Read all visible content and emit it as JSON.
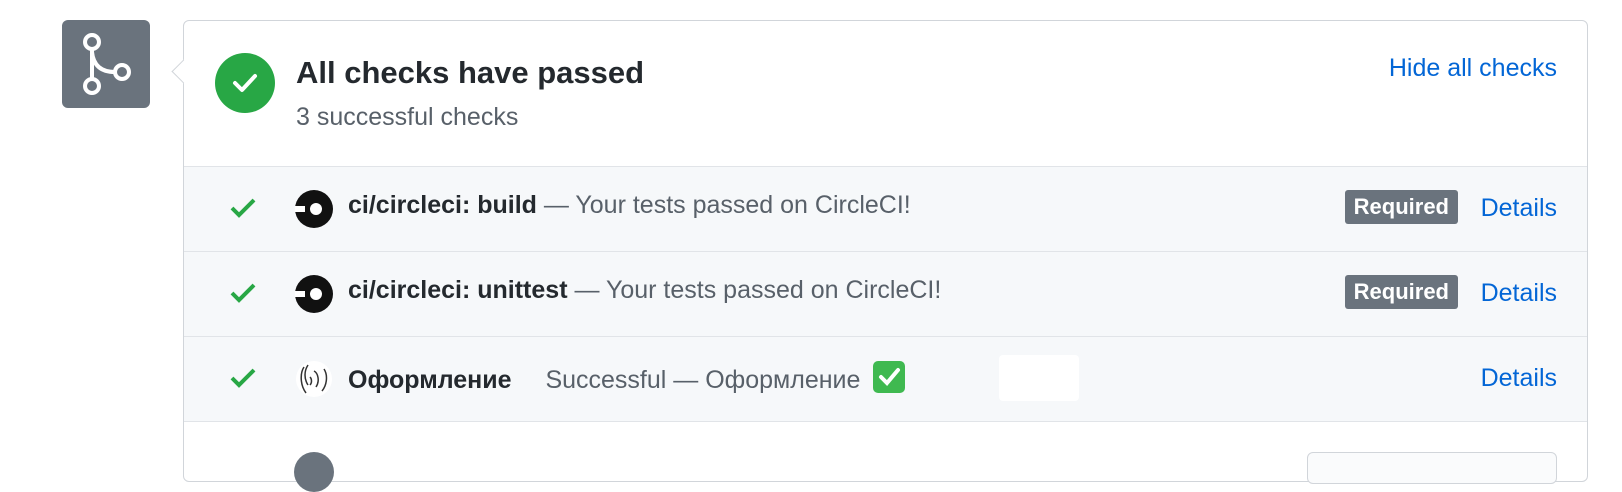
{
  "header": {
    "title": "All checks have passed",
    "subtitle": "3 successful checks",
    "hide_link": "Hide all checks"
  },
  "checks": [
    {
      "name": "ci/circleci: build",
      "description": " — Your tests passed on CircleCI!",
      "required_badge": "Required",
      "details_label": "Details",
      "icon": "circleci-logo-icon"
    },
    {
      "name": "ci/circleci: unittest",
      "description": " — Your tests passed on CircleCI!",
      "required_badge": "Required",
      "details_label": "Details",
      "icon": "circleci-logo-icon"
    },
    {
      "name": "Оформление",
      "description": "Successful — Оформление",
      "details_label": "Details",
      "icon": "pushkin-avatar-icon"
    }
  ],
  "colors": {
    "success": "#28a745",
    "link": "#0366d6",
    "badge_gray": "#6a737d"
  }
}
